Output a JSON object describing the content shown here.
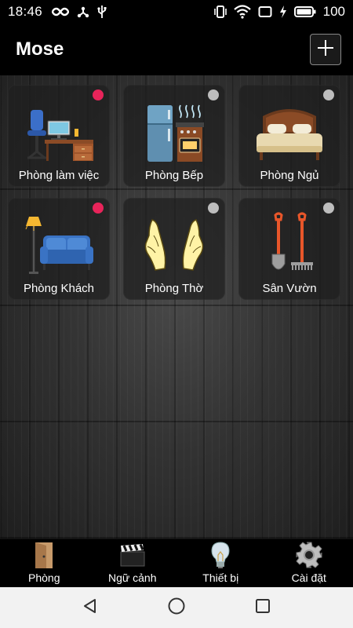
{
  "status_bar": {
    "time": "18:46",
    "battery": "100",
    "icons": [
      "infinity-icon",
      "share-icon",
      "usb-icon",
      "vibrate-icon",
      "wifi-icon",
      "screen-icon",
      "charging-icon",
      "battery-icon"
    ]
  },
  "app_bar": {
    "title": "Mose",
    "add_icon": "plus-icon"
  },
  "rooms": [
    {
      "label": "Phòng làm việc",
      "status_color": "#e8245a",
      "icon": "desk-icon"
    },
    {
      "label": "Phòng Bếp",
      "status_color": "#bdbdbd",
      "icon": "kitchen-icon"
    },
    {
      "label": "Phòng Ngủ",
      "status_color": "#bdbdbd",
      "icon": "bed-icon"
    },
    {
      "label": "Phòng Khách",
      "status_color": "#e8245a",
      "icon": "sofa-icon"
    },
    {
      "label": "Phòng Thờ",
      "status_color": "#bdbdbd",
      "icon": "praying-hands-icon"
    },
    {
      "label": "Sân Vườn",
      "status_color": "#bdbdbd",
      "icon": "garden-tools-icon"
    }
  ],
  "tabs": [
    {
      "label": "Phòng",
      "icon": "door-icon"
    },
    {
      "label": "Ngữ cảnh",
      "icon": "clapperboard-icon"
    },
    {
      "label": "Thiết bị",
      "icon": "lightbulb-icon"
    },
    {
      "label": "Cài đặt",
      "icon": "gear-icon"
    }
  ],
  "nav": [
    "back-icon",
    "home-icon",
    "recents-icon"
  ]
}
